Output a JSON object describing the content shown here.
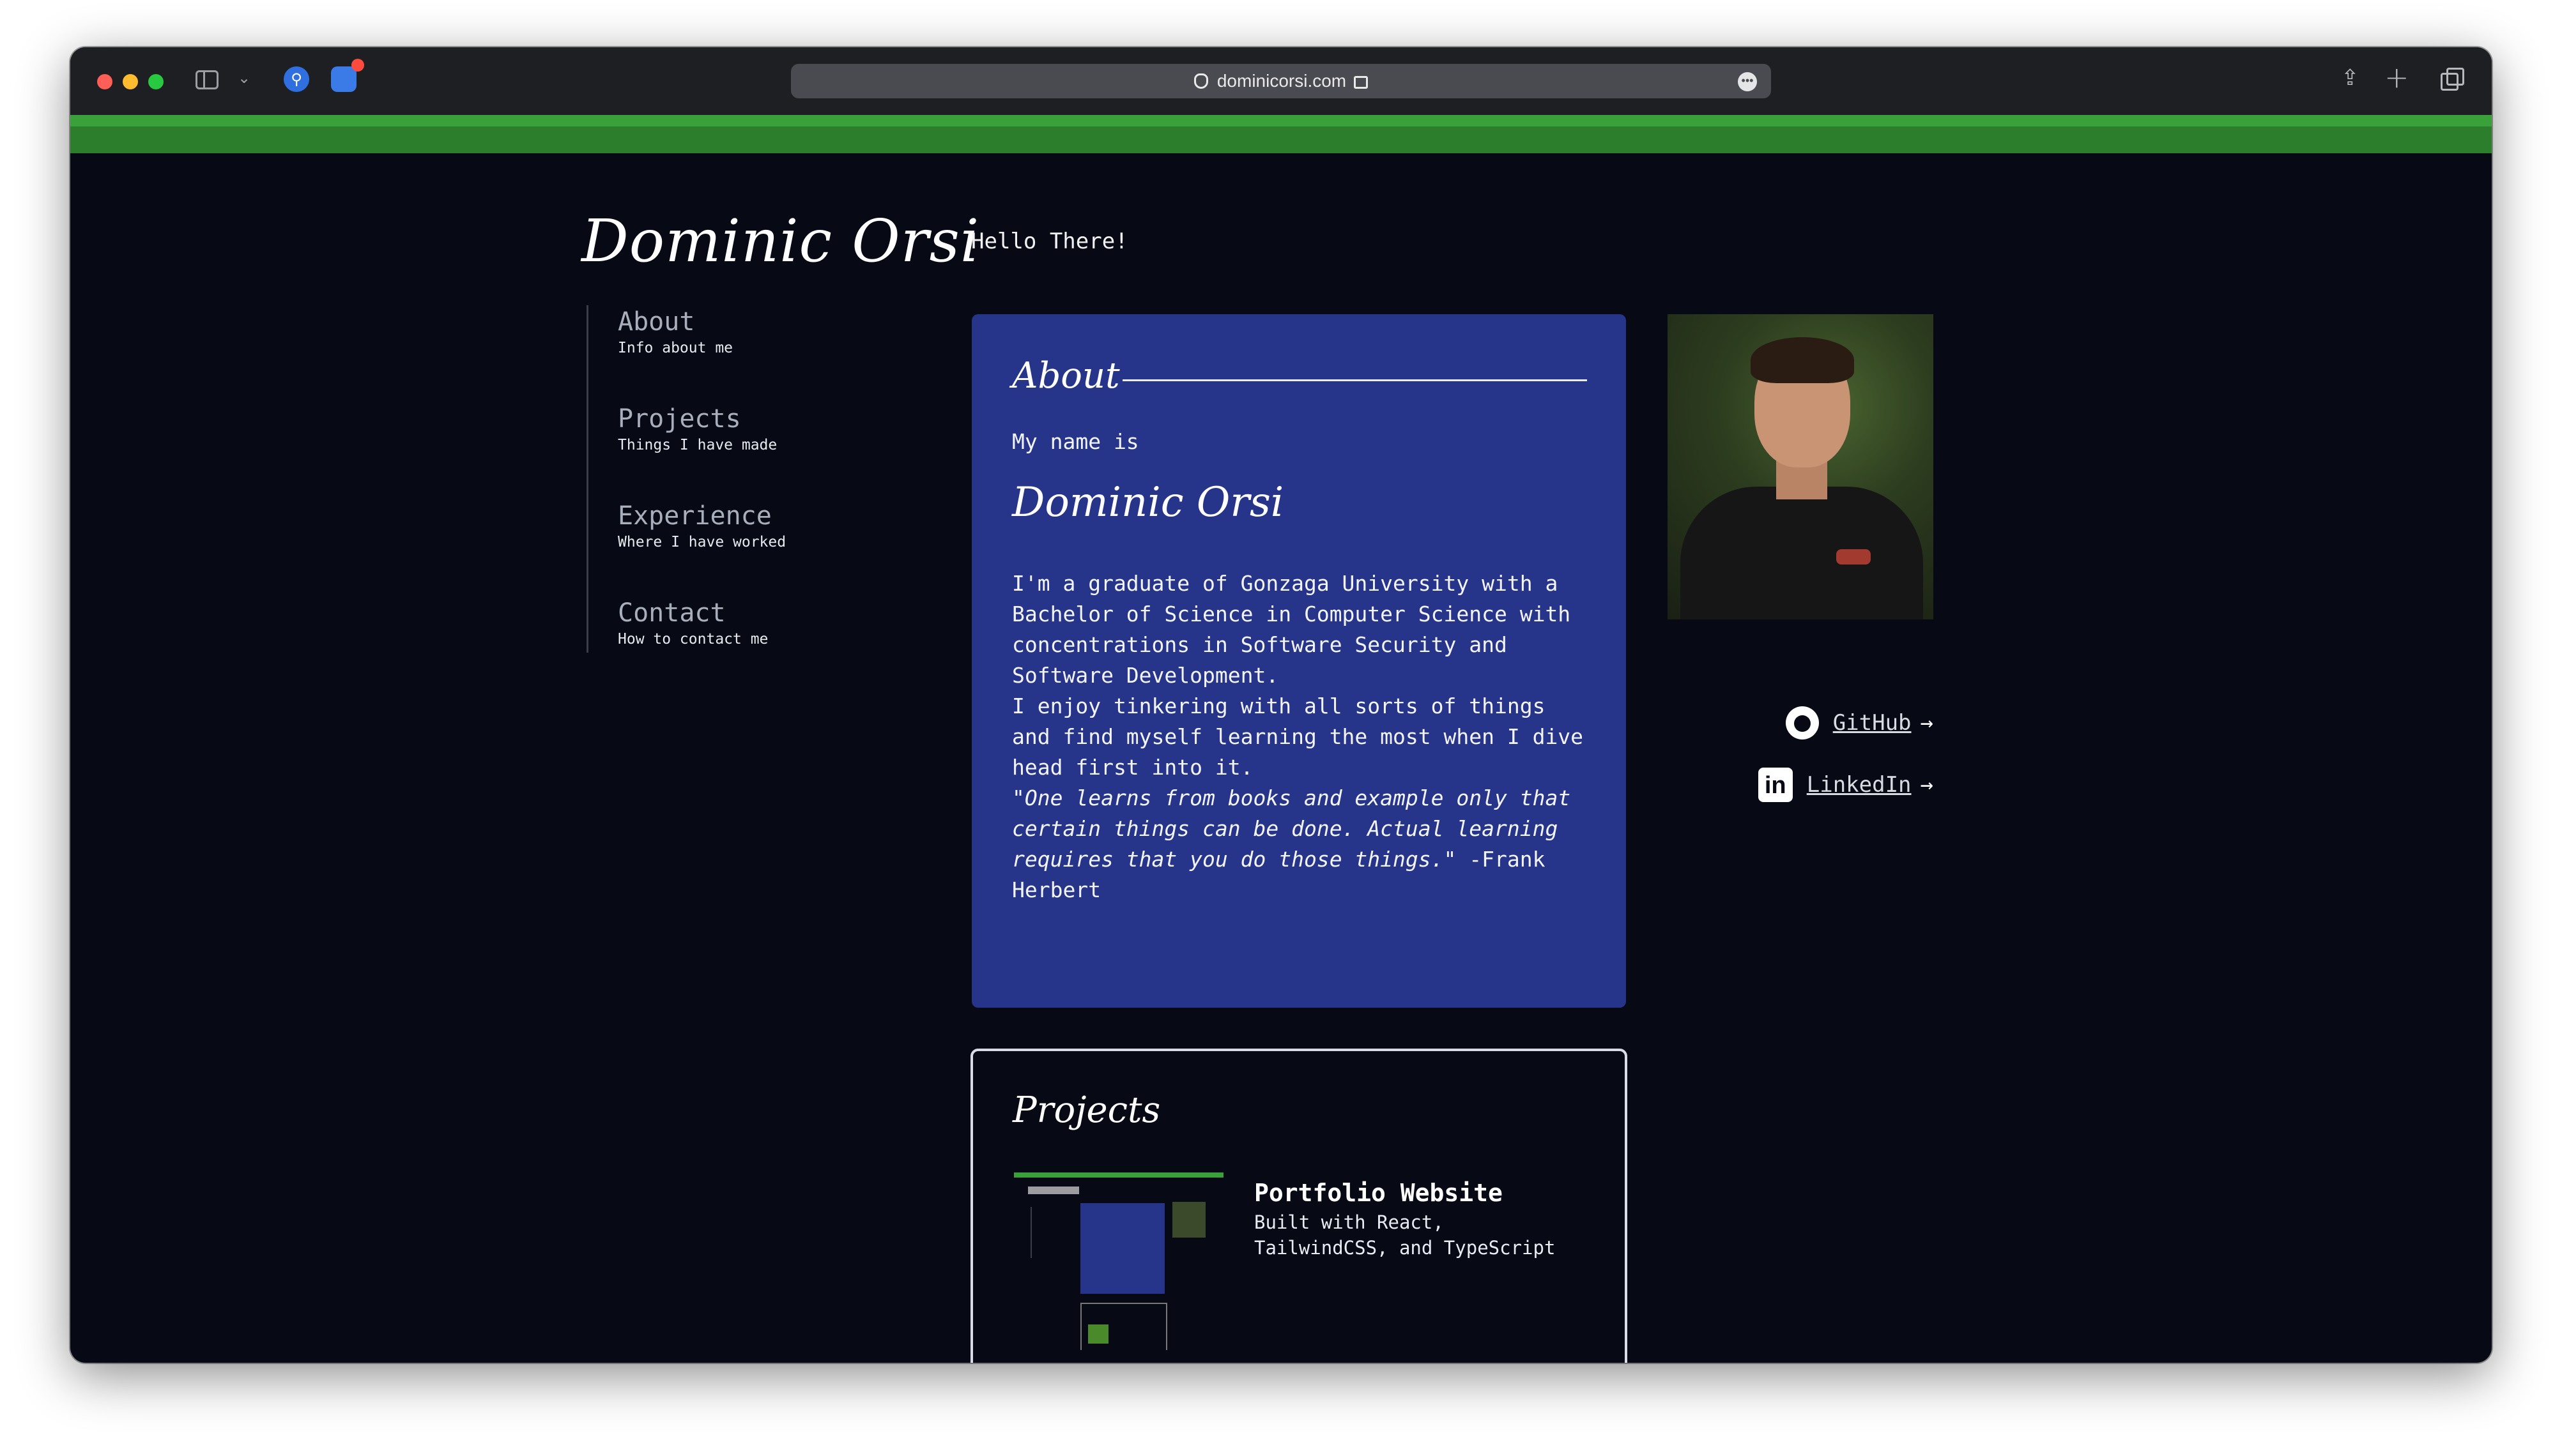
{
  "browser": {
    "url": "dominicorsi.com"
  },
  "site": {
    "brand": "Dominic Orsi",
    "tagline": "Hello There!"
  },
  "nav": [
    {
      "title": "About",
      "subtitle": "Info about me"
    },
    {
      "title": "Projects",
      "subtitle": "Things I have made"
    },
    {
      "title": "Experience",
      "subtitle": "Where I have worked"
    },
    {
      "title": "Contact",
      "subtitle": "How to contact me"
    }
  ],
  "about": {
    "heading": "About",
    "intro": "My name is",
    "name": "Dominic Orsi",
    "p1": "I'm a graduate of Gonzaga University with a Bachelor of Science in Computer Science with concentrations in Software Security and Software Development.",
    "p2": "I enjoy tinkering with all sorts of things and find myself learning the most when I dive head first into it.",
    "quote": "\"One learns from books and example only that certain things can be done. Actual learning requires that you do those things.\"",
    "quote_author": " -Frank Herbert"
  },
  "social": {
    "github": "GitHub",
    "linkedin": "LinkedIn",
    "arrow": "→"
  },
  "projects": {
    "heading": "Projects",
    "items": [
      {
        "title": "Portfolio Website",
        "description": "Built with React, TailwindCSS, and TypeScript"
      }
    ]
  },
  "colors": {
    "page_bg": "#070a15",
    "accent_green": "#3aa13a",
    "card_blue": "#26358a"
  }
}
